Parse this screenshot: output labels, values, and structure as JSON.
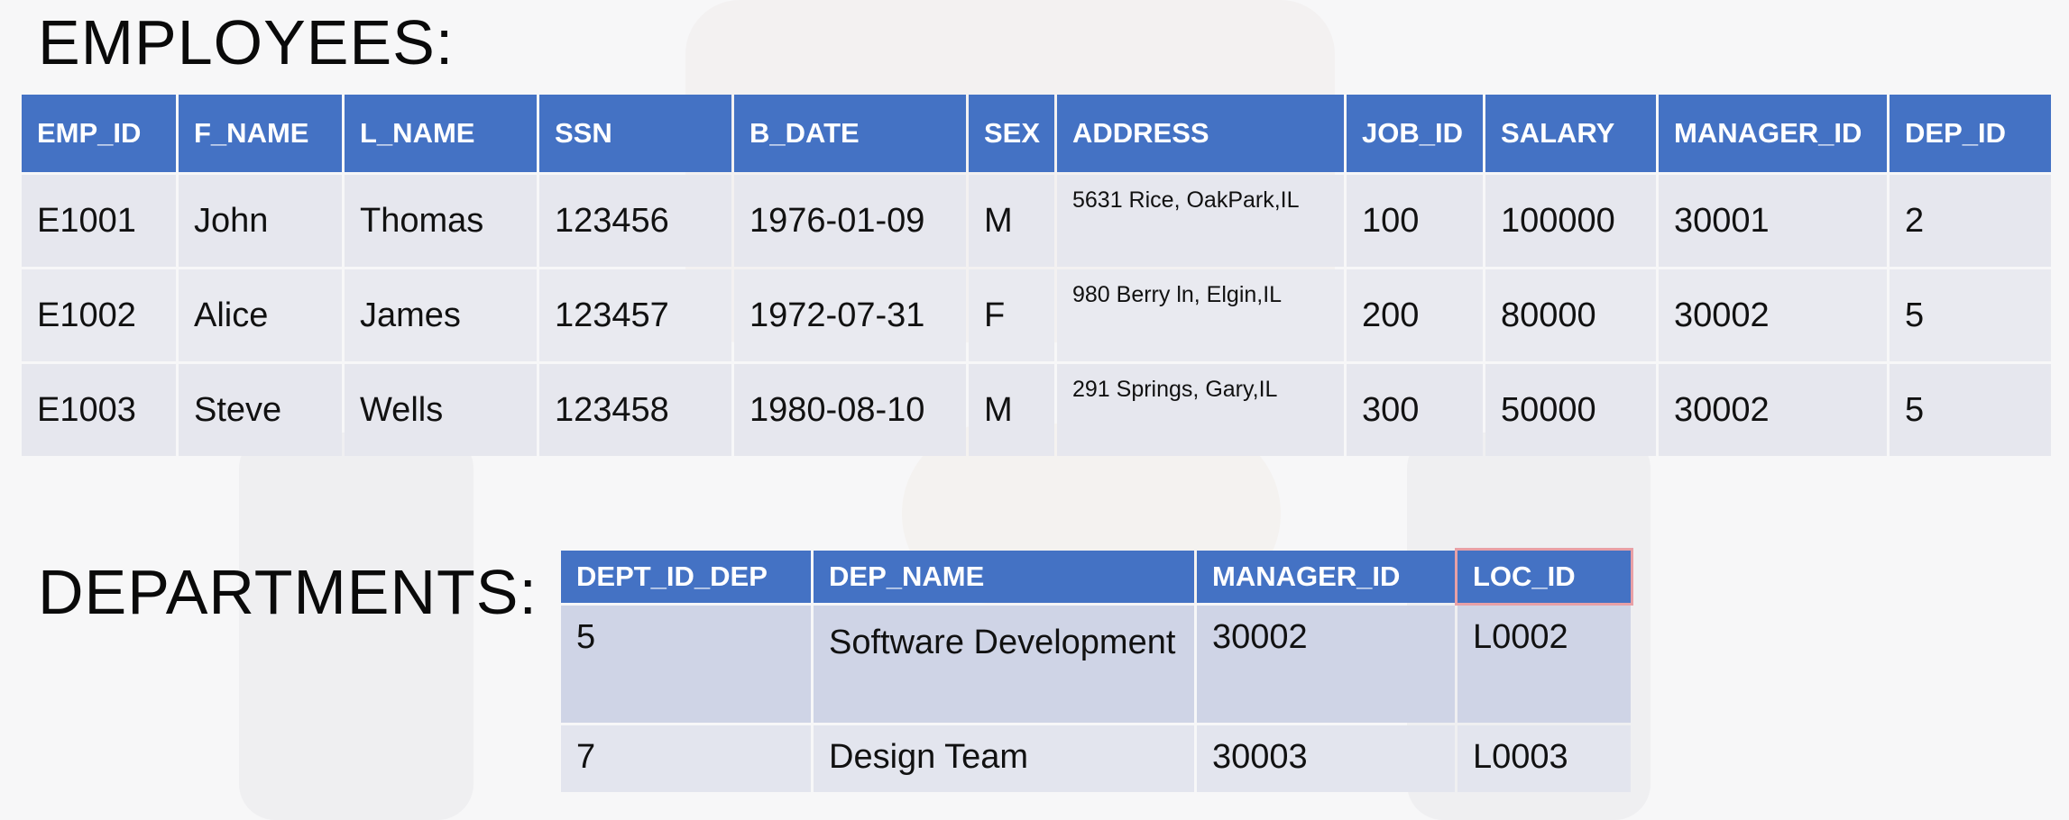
{
  "employees": {
    "title": "EMPLOYEES:",
    "columns": [
      "EMP_ID",
      "F_NAME",
      "L_NAME",
      "SSN",
      "B_DATE",
      "SEX",
      "ADDRESS",
      "JOB_ID",
      "SALARY",
      "MANAGER_ID",
      "DEP_ID"
    ],
    "rows": [
      [
        "E1001",
        "John",
        "Thomas",
        "123456",
        "1976-01-09",
        "M",
        "5631 Rice, OakPark,IL",
        "100",
        "100000",
        "30001",
        "2"
      ],
      [
        "E1002",
        "Alice",
        "James",
        "123457",
        "1972-07-31",
        "F",
        "980 Berry ln, Elgin,IL",
        "200",
        "80000",
        "30002",
        "5"
      ],
      [
        "E1003",
        "Steve",
        "Wells",
        "123458",
        "1980-08-10",
        "M",
        "291 Springs, Gary,IL",
        "300",
        "50000",
        "30002",
        "5"
      ]
    ]
  },
  "departments": {
    "title": "DEPARTMENTS:",
    "columns": [
      "DEPT_ID_DEP",
      "DEP_NAME",
      "MANAGER_ID",
      "LOC_ID"
    ],
    "highlighted_column": "LOC_ID",
    "rows": [
      [
        "5",
        "Software Development",
        "30002",
        "L0002"
      ],
      [
        "7",
        "Design Team",
        "30003",
        "L0003"
      ]
    ]
  },
  "colors": {
    "header_bg": "#4472c4",
    "header_text": "#ffffff",
    "row_bg": "#e6e7ee",
    "highlight_border": "#e8a0a6"
  }
}
